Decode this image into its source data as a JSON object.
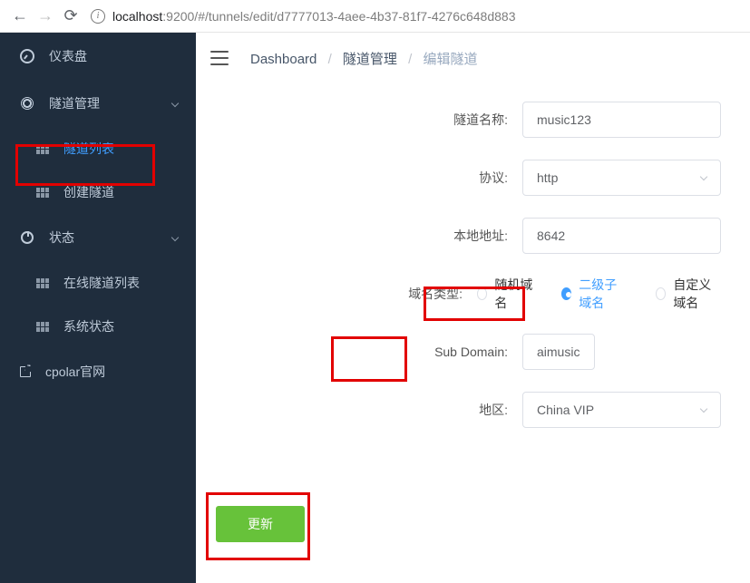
{
  "browser": {
    "url_host": "localhost",
    "url_rest": ":9200/#/tunnels/edit/d7777013-4aee-4b37-81f7-4276c648d883"
  },
  "sidebar": {
    "dashboard": "仪表盘",
    "tunnel_mgmt": "隧道管理",
    "tunnel_list": "隧道列表",
    "tunnel_create": "创建隧道",
    "status": "状态",
    "status_online": "在线隧道列表",
    "status_system": "系统状态",
    "official": "cpolar官网"
  },
  "breadcrumb": {
    "a": "Dashboard",
    "b": "隧道管理",
    "c": "编辑隧道"
  },
  "form": {
    "name_label": "隧道名称:",
    "name_value": "music123",
    "proto_label": "协议:",
    "proto_value": "http",
    "addr_label": "本地地址:",
    "addr_value": "8642",
    "domain_type_label": "域名类型:",
    "domain_type_opts": {
      "random": "随机域名",
      "sub": "二级子域名",
      "custom": "自定义域名"
    },
    "subdomain_label": "Sub Domain:",
    "subdomain_value": "aimusic",
    "region_label": "地区:",
    "region_value": "China VIP",
    "submit": "更新"
  }
}
